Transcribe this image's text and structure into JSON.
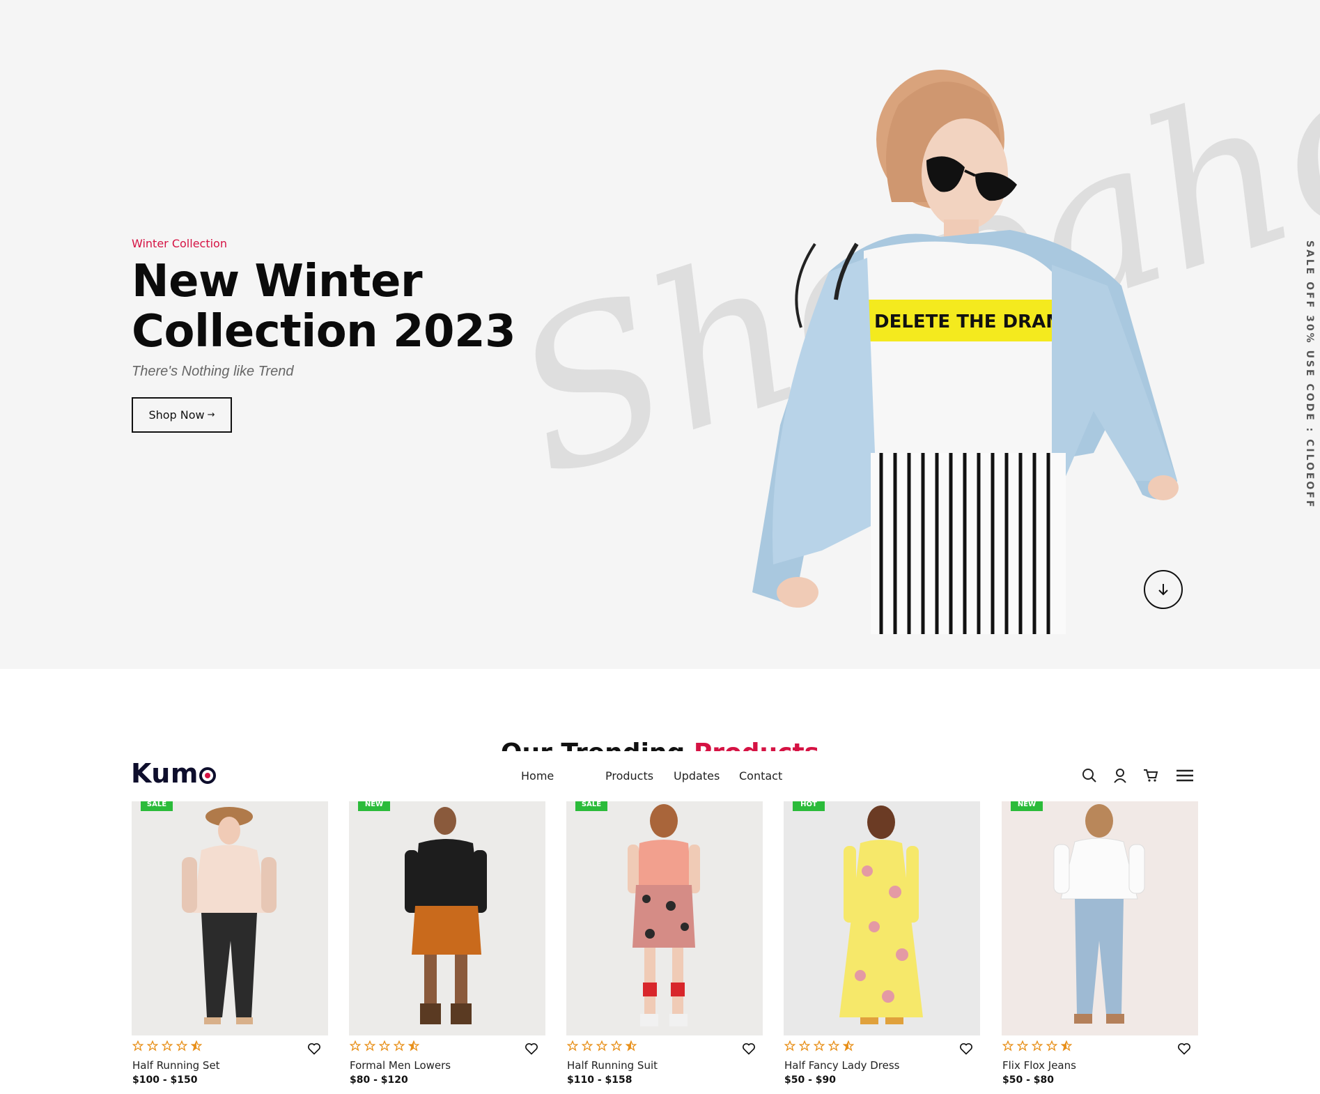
{
  "hero": {
    "subtitle": "Winter Collection",
    "title": "New Winter Collection 2023",
    "tagline": "There's Nothing like Trend",
    "button_label": "Shop Now",
    "button_arrow": "→",
    "script_text": "Shopaholic",
    "shirt_text": "DELETE THE DRAMA",
    "vertical_note": "SALE OFF 30% USE CODE : CILOEOFF"
  },
  "section": {
    "heading_main": "Our Trending ",
    "heading_accent": "Products"
  },
  "header": {
    "logo": "Kum",
    "nav": [
      "Home",
      "Products",
      "Updates",
      "Contact"
    ]
  },
  "products": [
    {
      "badge": "SALE",
      "name": "Half Running Set",
      "price": "$100 - $150"
    },
    {
      "badge": "NEW",
      "name": "Formal Men Lowers",
      "price": "$80 - $120"
    },
    {
      "badge": "SALE",
      "name": "Half Running Suit",
      "price": "$110 - $158"
    },
    {
      "badge": "HOT",
      "name": "Half Fancy Lady Dress",
      "price": "$50 - $90"
    },
    {
      "badge": "NEW",
      "name": "Flix Flox Jeans",
      "price": "$50 - $80"
    }
  ],
  "colors": {
    "accent": "#d51243",
    "badge_green": "#2bbb3a",
    "star_orange": "#e8901a",
    "hero_bg": "#f5f5f5"
  },
  "icons": [
    "search-icon",
    "user-icon",
    "cart-icon",
    "menu-icon",
    "arrow-down-icon",
    "heart-icon",
    "star-icon",
    "half-star-icon"
  ]
}
